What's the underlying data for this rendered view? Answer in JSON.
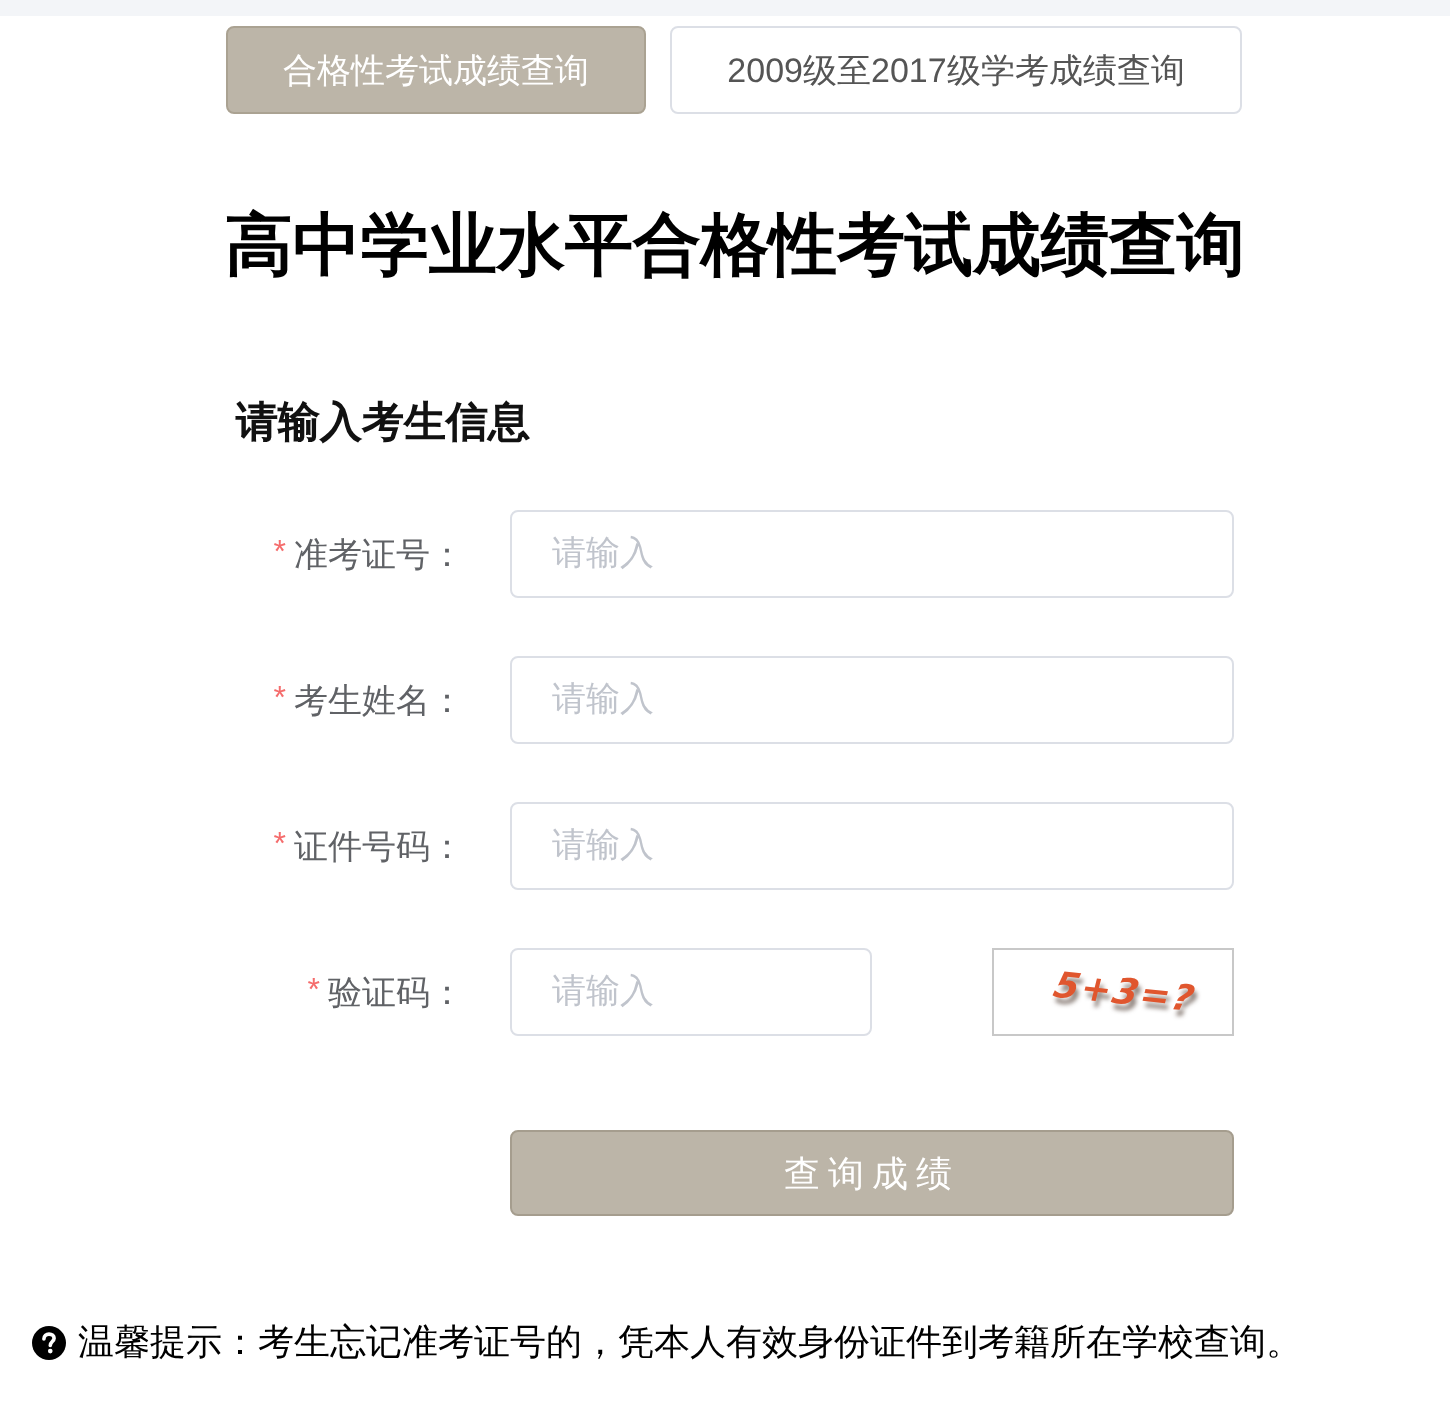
{
  "tabs": [
    {
      "label": "合格性考试成绩查询",
      "selected": true
    },
    {
      "label": "2009级至2017级学考成绩查询",
      "selected": false
    }
  ],
  "title": "高中学业水平合格性考试成绩查询",
  "form": {
    "heading": "请输入考生信息",
    "fields": [
      {
        "kind": "text",
        "mark": "*",
        "label": "准考证号：",
        "placeholder": "请输入"
      },
      {
        "kind": "text",
        "mark": "*",
        "label": "考生姓名：",
        "placeholder": "请输入"
      },
      {
        "kind": "text",
        "mark": "*",
        "label": "证件号码：",
        "placeholder": "请输入"
      },
      {
        "kind": "captcha",
        "mark": "*",
        "label": "验证码：",
        "placeholder": "请输入",
        "captcha": "5+3=?"
      }
    ],
    "submit": "查询成绩"
  },
  "tip": "温馨提示：考生忘记准考证号的，凭本人有效身份证件到考籍所在学校查询。"
}
